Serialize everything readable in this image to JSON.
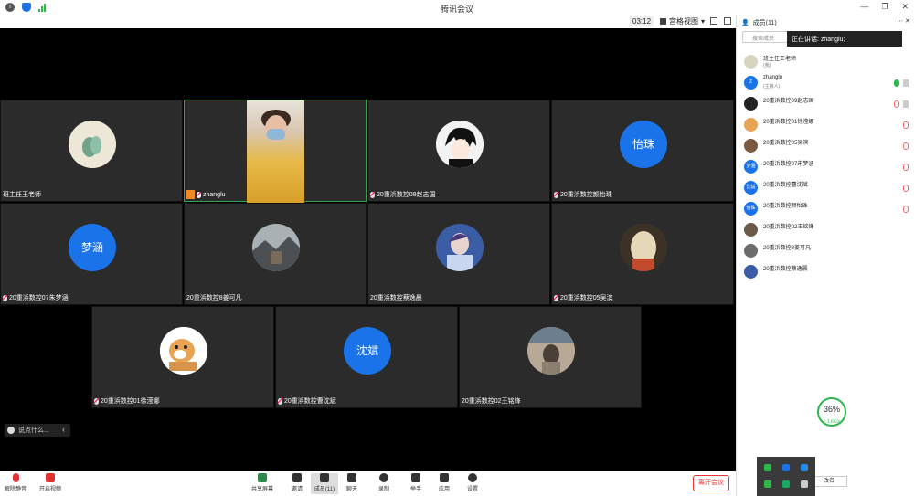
{
  "window": {
    "title": "腾讯会议"
  },
  "toolbar_top": {
    "timer": "03:12",
    "view_label": "宫格视图",
    "members_header": "成员(11)"
  },
  "tiles": [
    {
      "name": "班主任王老师"
    },
    {
      "name": "zhanglu"
    },
    {
      "name": "20重浜数控09赵志国"
    },
    {
      "name": "20重浜数控颜怡珠",
      "avatar_text": "怡珠"
    },
    {
      "name": "20重浜数控07朱梦涵",
      "avatar_text": "梦涵"
    },
    {
      "name": "20重浜数控8姜可凡"
    },
    {
      "name": "20重浜数控蔡逸晨"
    },
    {
      "name": "20重浜数控05吴滨"
    },
    {
      "name": "20重浜数控01徐滢娜"
    },
    {
      "name": "20重浜数控曹沈斌",
      "avatar_text": "沈斌"
    },
    {
      "name": "20重浜数控02王铭烽"
    }
  ],
  "chat": {
    "placeholder": "说点什么..."
  },
  "bottom": {
    "unmute": "解除静音",
    "video": "开启视频",
    "share": "共享屏幕",
    "invite": "邀请",
    "members": "成员(11)",
    "chat": "聊天",
    "record": "录制",
    "raise": "举手",
    "apps": "应用",
    "settings": "设置",
    "leave": "离开会议"
  },
  "panel": {
    "search_placeholder": "搜索成员",
    "speaking": "正在讲话: zhanglu;",
    "members": [
      {
        "name": "班主任王老师",
        "role": "(我)",
        "mic": "none"
      },
      {
        "name": "zhanglu",
        "role": "(主持人)",
        "mic": "on",
        "avatar_text": "Z"
      },
      {
        "name": "20重浜数控09赵志国",
        "mic": "muted"
      },
      {
        "name": "20重浜数控01徐滢娜",
        "mic": "muted"
      },
      {
        "name": "20重浜数控05吴滨",
        "mic": "muted"
      },
      {
        "name": "20重浜数控07朱梦涵",
        "mic": "muted",
        "avatar_text": "梦涵"
      },
      {
        "name": "20重浜数控曹沈斌",
        "mic": "muted",
        "avatar_text": "沈斌"
      },
      {
        "name": "20重浜数控颜怡珠",
        "mic": "muted",
        "avatar_text": "怡珠"
      },
      {
        "name": "20重浜数控02王铭烽",
        "mic": "none"
      },
      {
        "name": "20重浜数控8姜可凡",
        "mic": "none"
      },
      {
        "name": "20重浜数控蔡逸晨",
        "mic": "none"
      }
    ],
    "net_percent": "36%",
    "net_speed": "↑ 1.6K/s",
    "invite_btn": "改名"
  }
}
